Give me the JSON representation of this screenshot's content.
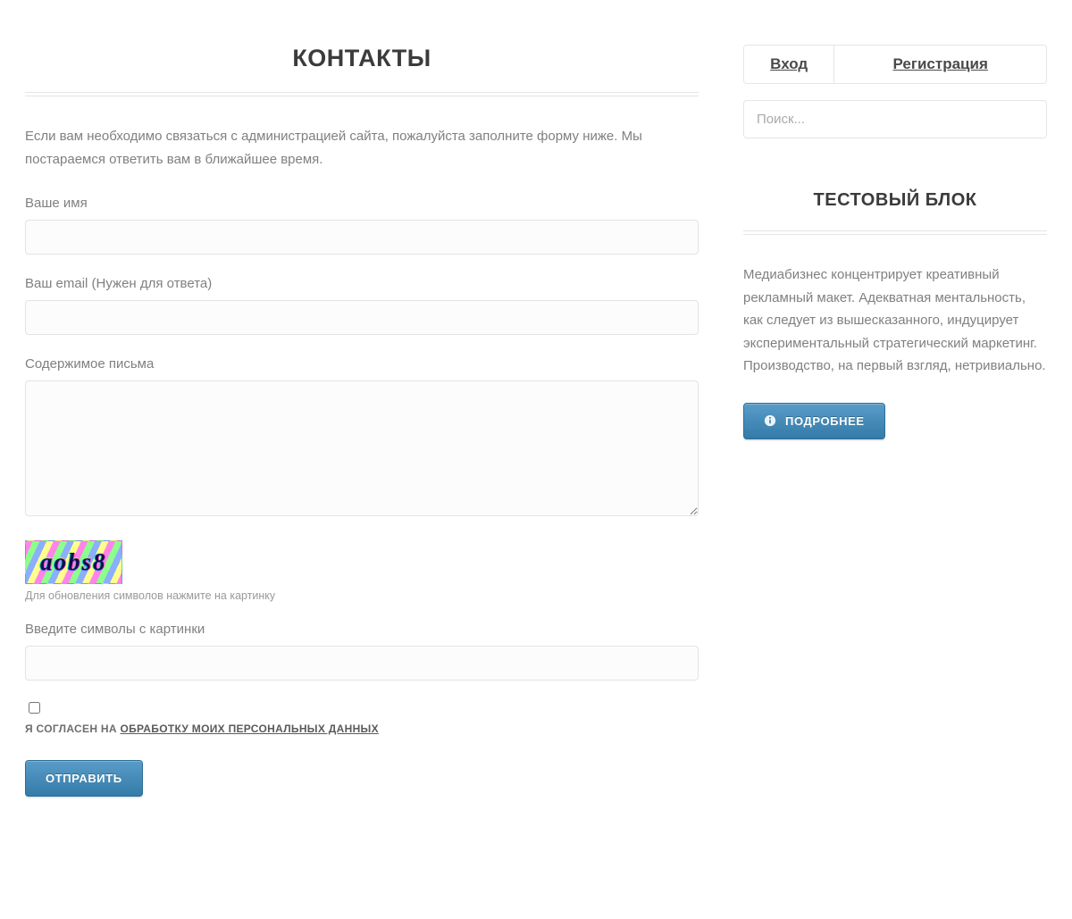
{
  "main": {
    "title": "КОНТАКТЫ",
    "intro": "Если вам необходимо связаться с администрацией сайта, пожалуйста заполните форму ниже. Мы постараемся ответить вам в ближайшее время.",
    "labels": {
      "name": "Ваше имя",
      "email": "Ваш email (Нужен для ответа)",
      "body": "Содержимое письма",
      "captcha": "Введите символы с картинки"
    },
    "captcha": {
      "text": "aobs8",
      "hint": "Для обновления символов нажмите на картинку"
    },
    "consent": {
      "prefix": "Я СОГЛАСЕН НА ",
      "link": "ОБРАБОТКУ МОИХ ПЕРСОНАЛЬНЫХ ДАННЫХ"
    },
    "submit": "ОТПРАВИТЬ"
  },
  "sidebar": {
    "login": "Вход",
    "register": "Регистрация",
    "search_placeholder": "Поиск...",
    "block": {
      "title": "ТЕСТОВЫЙ БЛОК",
      "body": "Медиабизнес концентрирует креативный рекламный макет. Адекватная ментальность, как следует из вышесказанного, индуцирует экспериментальный стратегический маркетинг. Производство, на первый взгляд, нетривиально.",
      "more": "ПОДРОБНЕЕ"
    }
  }
}
